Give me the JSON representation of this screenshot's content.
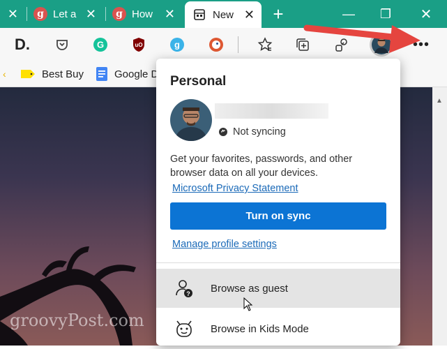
{
  "tabs": [
    {
      "title": "Let a",
      "close": "✕"
    },
    {
      "title": "How",
      "close": "✕"
    },
    {
      "title": "New",
      "close": "✕"
    }
  ],
  "tab_close_first": "✕",
  "new_tab": "+",
  "window": {
    "minimize": "—",
    "maximize": "❐",
    "close": "✕"
  },
  "favorites": [
    {
      "label": "Best Buy"
    },
    {
      "label": "Google D"
    }
  ],
  "profile": {
    "heading": "Personal",
    "sync_status": "Not syncing",
    "description": "Get your favorites, passwords, and other browser data on all your devices.",
    "privacy_link": "Microsoft Privacy Statement",
    "sync_button": "Turn on sync",
    "manage_link": "Manage profile settings"
  },
  "menu": [
    {
      "label": "Browse as guest",
      "icon": "guest-icon"
    },
    {
      "label": "Browse in Kids Mode",
      "icon": "kids-mode-icon"
    }
  ],
  "watermark": "groovyPost.com",
  "colors": {
    "titlebar": "#1a9f86",
    "sync_button": "#0c74d4",
    "arrow": "#e5453f"
  }
}
